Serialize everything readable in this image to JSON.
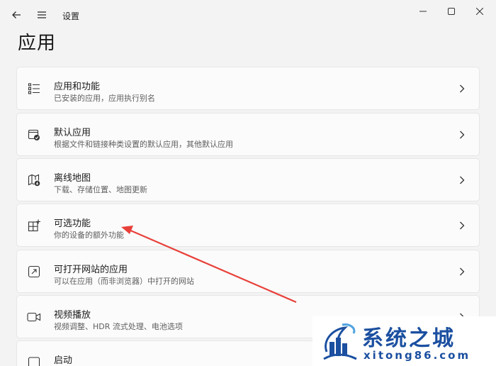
{
  "window": {
    "title": "设置",
    "back_icon": "back-arrow-icon",
    "menu_icon": "hamburger-menu-icon"
  },
  "page": {
    "title": "应用"
  },
  "items": [
    {
      "title": "应用和功能",
      "subtitle": "已安装的应用，应用执行别名",
      "icon": "apps-list-icon"
    },
    {
      "title": "默认应用",
      "subtitle": "根据文件和链接种类设置的默认应用，其他默认应用",
      "icon": "default-apps-icon"
    },
    {
      "title": "离线地图",
      "subtitle": "下载、存储位置、地图更新",
      "icon": "offline-map-icon"
    },
    {
      "title": "可选功能",
      "subtitle": "你的设备的额外功能",
      "icon": "optional-features-icon"
    },
    {
      "title": "可打开网站的应用",
      "subtitle": "可以在应用（而非浏览器）中打开的网站",
      "icon": "open-web-icon"
    },
    {
      "title": "视频播放",
      "subtitle": "视频调整、HDR 流式处理、电池选项",
      "icon": "video-playback-icon"
    },
    {
      "title": "启动",
      "subtitle": "",
      "icon": "startup-icon"
    }
  ],
  "watermark": {
    "name": "系统之城",
    "url": "xitong86.com"
  },
  "colors": {
    "accent": "#1b4fa0",
    "annotation_arrow": "#e8413a"
  }
}
